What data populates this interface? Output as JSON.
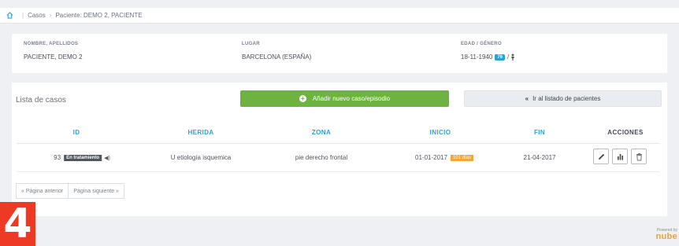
{
  "breadcrumb": {
    "items": [
      "Casos",
      "Paciente: DEMO 2, PACIENTE"
    ]
  },
  "patient": {
    "name_label": "NOMBRE, APELLIDOS",
    "name_value": "PACIENTE, DEMO 2",
    "place_label": "LUGAR",
    "place_value": "BARCELONA  (ESPAÑA)",
    "age_label": "EDAD / GÉNERO",
    "dob_value": "18-11-1940",
    "age_value": "76",
    "gender_sep": "/"
  },
  "cases": {
    "title": "Lista de casos",
    "new_button_label": "Añadir nuevo caso/episodio",
    "back_button_label": "Ir al listado de pacientes",
    "columns": [
      "ID",
      "HERIDA",
      "ZONA",
      "INICIO",
      "FIN",
      "ACCIONES"
    ],
    "rows": [
      {
        "id": "93",
        "status": "En tratamiento",
        "wound": "U etiología isquemica",
        "zone": "pie derecho frontal",
        "start": "01-01-2017",
        "days": "101 días",
        "end": "21-04-2017"
      }
    ]
  },
  "pager": {
    "prev": "« Página anterior",
    "next": "Página siguiente »"
  },
  "overlay": {
    "number": "4"
  },
  "footer": {
    "powered_by": "Powered by",
    "brand": "nube"
  },
  "colors": {
    "accent_blue": "#2aa3d9",
    "green": "#6cb33f",
    "orange": "#f0a93b",
    "red": "#ee3a24"
  }
}
